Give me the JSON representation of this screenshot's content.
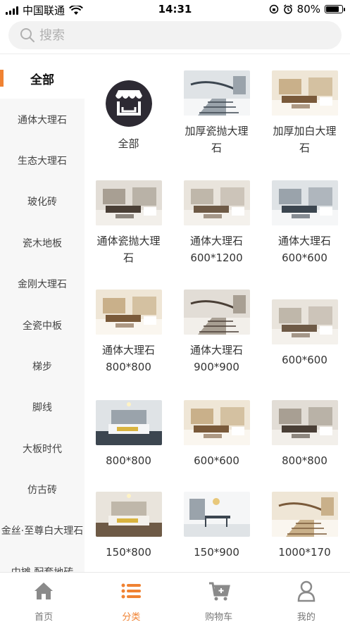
{
  "status_bar": {
    "carrier": "中国联通",
    "time": "14:31",
    "battery": "80%",
    "battery_level": 0.8
  },
  "search": {
    "placeholder": "搜索"
  },
  "sidebar": {
    "items": [
      {
        "label": "全部",
        "active": true
      },
      {
        "label": "通体大理石"
      },
      {
        "label": "生态大理石"
      },
      {
        "label": "玻化砖"
      },
      {
        "label": "瓷木地板"
      },
      {
        "label": "金刚大理石"
      },
      {
        "label": "全瓷中板"
      },
      {
        "label": "梯步"
      },
      {
        "label": "脚线"
      },
      {
        "label": "大板时代"
      },
      {
        "label": "仿古砖"
      },
      {
        "label": "金丝·至尊白大理石"
      },
      {
        "label": "中摊 配套地砖"
      }
    ]
  },
  "grid": {
    "items": [
      {
        "label": "全部",
        "icon": "store-icon"
      },
      {
        "label": "加厚瓷抛大理石",
        "image": "staircase-photo"
      },
      {
        "label": "加厚加白大理石",
        "image": "living-room-photo"
      },
      {
        "label": "通体瓷抛大理石",
        "image": "living-room-photo"
      },
      {
        "label": "通体大理石600*1200",
        "image": "living-room-photo"
      },
      {
        "label": "通体大理石600*600",
        "image": "living-room-photo"
      },
      {
        "label": "通体大理石800*800",
        "image": "living-room-photo"
      },
      {
        "label": "通体大理石900*900",
        "image": "staircase-photo"
      },
      {
        "label": "600*600",
        "image": "living-room-photo"
      },
      {
        "label": "800*800",
        "image": "bedroom-photo"
      },
      {
        "label": "600*600",
        "image": "living-room-photo"
      },
      {
        "label": "800*800",
        "image": "living-room-photo"
      },
      {
        "label": "150*800",
        "image": "bedroom-photo"
      },
      {
        "label": "150*900",
        "image": "dining-room-photo"
      },
      {
        "label": "1000*170",
        "image": "staircase-photo"
      }
    ]
  },
  "tabbar": {
    "items": [
      {
        "label": "首页",
        "icon": "home-icon"
      },
      {
        "label": "分类",
        "icon": "list-icon",
        "active": true
      },
      {
        "label": "购物车",
        "icon": "cart-icon"
      },
      {
        "label": "我的",
        "icon": "user-icon"
      }
    ]
  },
  "colors": {
    "accent": "#f08232",
    "sidebar_bg": "#f7f7f7"
  }
}
